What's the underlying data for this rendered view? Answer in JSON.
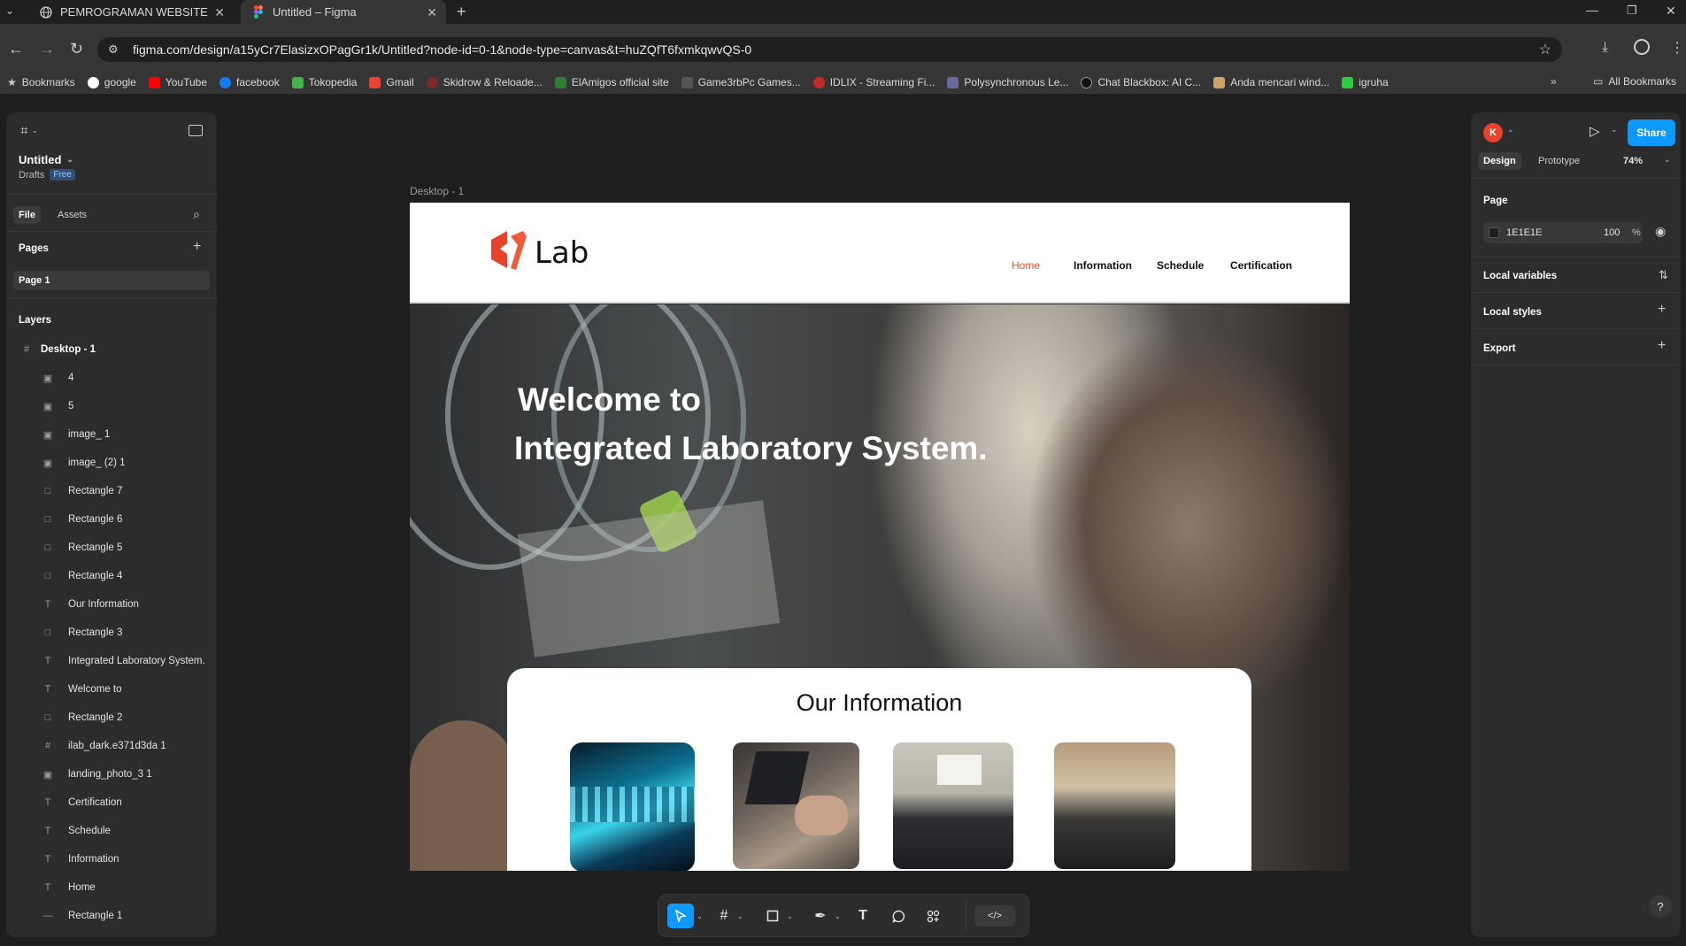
{
  "browser": {
    "tabs": [
      {
        "title": "PEMROGRAMAN WEBSITE",
        "icon": "globe-icon"
      },
      {
        "title": "Untitled – Figma",
        "icon": "figma-icon"
      }
    ],
    "url": "figma.com/design/a15yCr7ElasizxOPagGr1k/Untitled?node-id=0-1&node-type=canvas&t=huZQfT6fxmkqwvQS-0",
    "bookmarks_label": "Bookmarks",
    "bookmarks": [
      "google",
      "YouTube",
      "facebook",
      "Tokopedia",
      "Gmail",
      "Skidrow & Reloade...",
      "ElAmigos official site",
      "Game3rbPc Games...",
      "IDLIX - Streaming Fi...",
      "Polysynchronous Le...",
      "Chat Blackbox: AI C...",
      "Anda mencari wind...",
      "igruha"
    ],
    "all_bookmarks": "All Bookmarks"
  },
  "figma": {
    "file_title": "Untitled",
    "drafts": "Drafts",
    "plan_badge": "Free",
    "tabs": {
      "file": "File",
      "assets": "Assets"
    },
    "pages_header": "Pages",
    "page": "Page 1",
    "layers_header": "Layers",
    "frame_layer": "Desktop - 1",
    "layers": [
      {
        "name": "4",
        "icon": "image-icon"
      },
      {
        "name": "5",
        "icon": "image-icon"
      },
      {
        "name": "image_ 1",
        "icon": "image-icon"
      },
      {
        "name": "image_ (2) 1",
        "icon": "image-icon"
      },
      {
        "name": "Rectangle 7",
        "icon": "rectangle-icon"
      },
      {
        "name": "Rectangle 6",
        "icon": "rectangle-icon"
      },
      {
        "name": "Rectangle 5",
        "icon": "rectangle-icon"
      },
      {
        "name": "Rectangle 4",
        "icon": "rectangle-icon"
      },
      {
        "name": "Our Information",
        "icon": "text-icon"
      },
      {
        "name": "Rectangle 3",
        "icon": "rectangle-icon"
      },
      {
        "name": "Integrated Laboratory System.",
        "icon": "text-icon"
      },
      {
        "name": "Welcome to",
        "icon": "text-icon"
      },
      {
        "name": "Rectangle 2",
        "icon": "rectangle-icon"
      },
      {
        "name": "ilab_dark.e371d3da 1",
        "icon": "frame-icon"
      },
      {
        "name": "landing_photo_3 1",
        "icon": "image-icon"
      },
      {
        "name": "Certification",
        "icon": "text-icon"
      },
      {
        "name": "Schedule",
        "icon": "text-icon"
      },
      {
        "name": "Information",
        "icon": "text-icon"
      },
      {
        "name": "Home",
        "icon": "text-icon"
      },
      {
        "name": "Rectangle 1",
        "icon": "line-icon"
      }
    ],
    "right": {
      "avatar_letter": "K",
      "share": "Share",
      "design_tab": "Design",
      "prototype_tab": "Prototype",
      "zoom": "74%",
      "page_section": "Page",
      "page_color": "1E1E1E",
      "page_opacity": "100",
      "percent": "%",
      "local_variables": "Local variables",
      "local_styles": "Local styles",
      "export": "Export",
      "help": "?"
    },
    "canvas": {
      "frame_label": "Desktop - 1",
      "logo_text": "Lab",
      "nav": [
        "Home",
        "Information",
        "Schedule",
        "Certification"
      ],
      "hero_line1": "Welcome to",
      "hero_line2": "Integrated Laboratory System.",
      "info_title": "Our Information"
    }
  },
  "colors": {
    "accent": "#0d99ff",
    "nav_active": "#f24e1e",
    "avatar": "#e8412c",
    "logo_red": "#e8412c"
  }
}
